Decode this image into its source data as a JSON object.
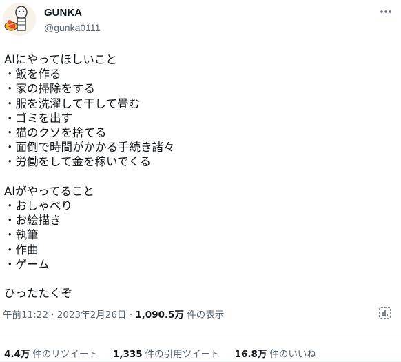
{
  "author": {
    "name": "GUNKA",
    "handle": "@gunka0111"
  },
  "tweet": {
    "text": "AIにやってほしいこと\n・飯を作る\n・家の掃除をする\n・服を洗濯して干して畳む\n・ゴミを出す\n・猫のクソを捨てる\n・面倒で時間がかかる手続き諸々\n・労働をして金を稼いでくる\n\nAIがやってること\n・おしゃべり\n・お絵描き\n・執筆\n・作曲\n・ゲーム\n\nひったたくぞ",
    "time": "午前11:22 · 2023年2月26日 · ",
    "views_count": "1,090.5万",
    "views_label": " 件の表示"
  },
  "stats": {
    "retweets_count": "4.4万",
    "retweets_label": "件のリツイート",
    "quotes_count": "1,335",
    "quotes_label": "件の引用ツイート",
    "likes_count": "16.8万",
    "likes_label": "件のいいね"
  },
  "icons": {
    "more": "more-icon",
    "analytics": "analytics-icon"
  },
  "colors": {
    "text": "#0f1419",
    "muted": "#536471"
  }
}
